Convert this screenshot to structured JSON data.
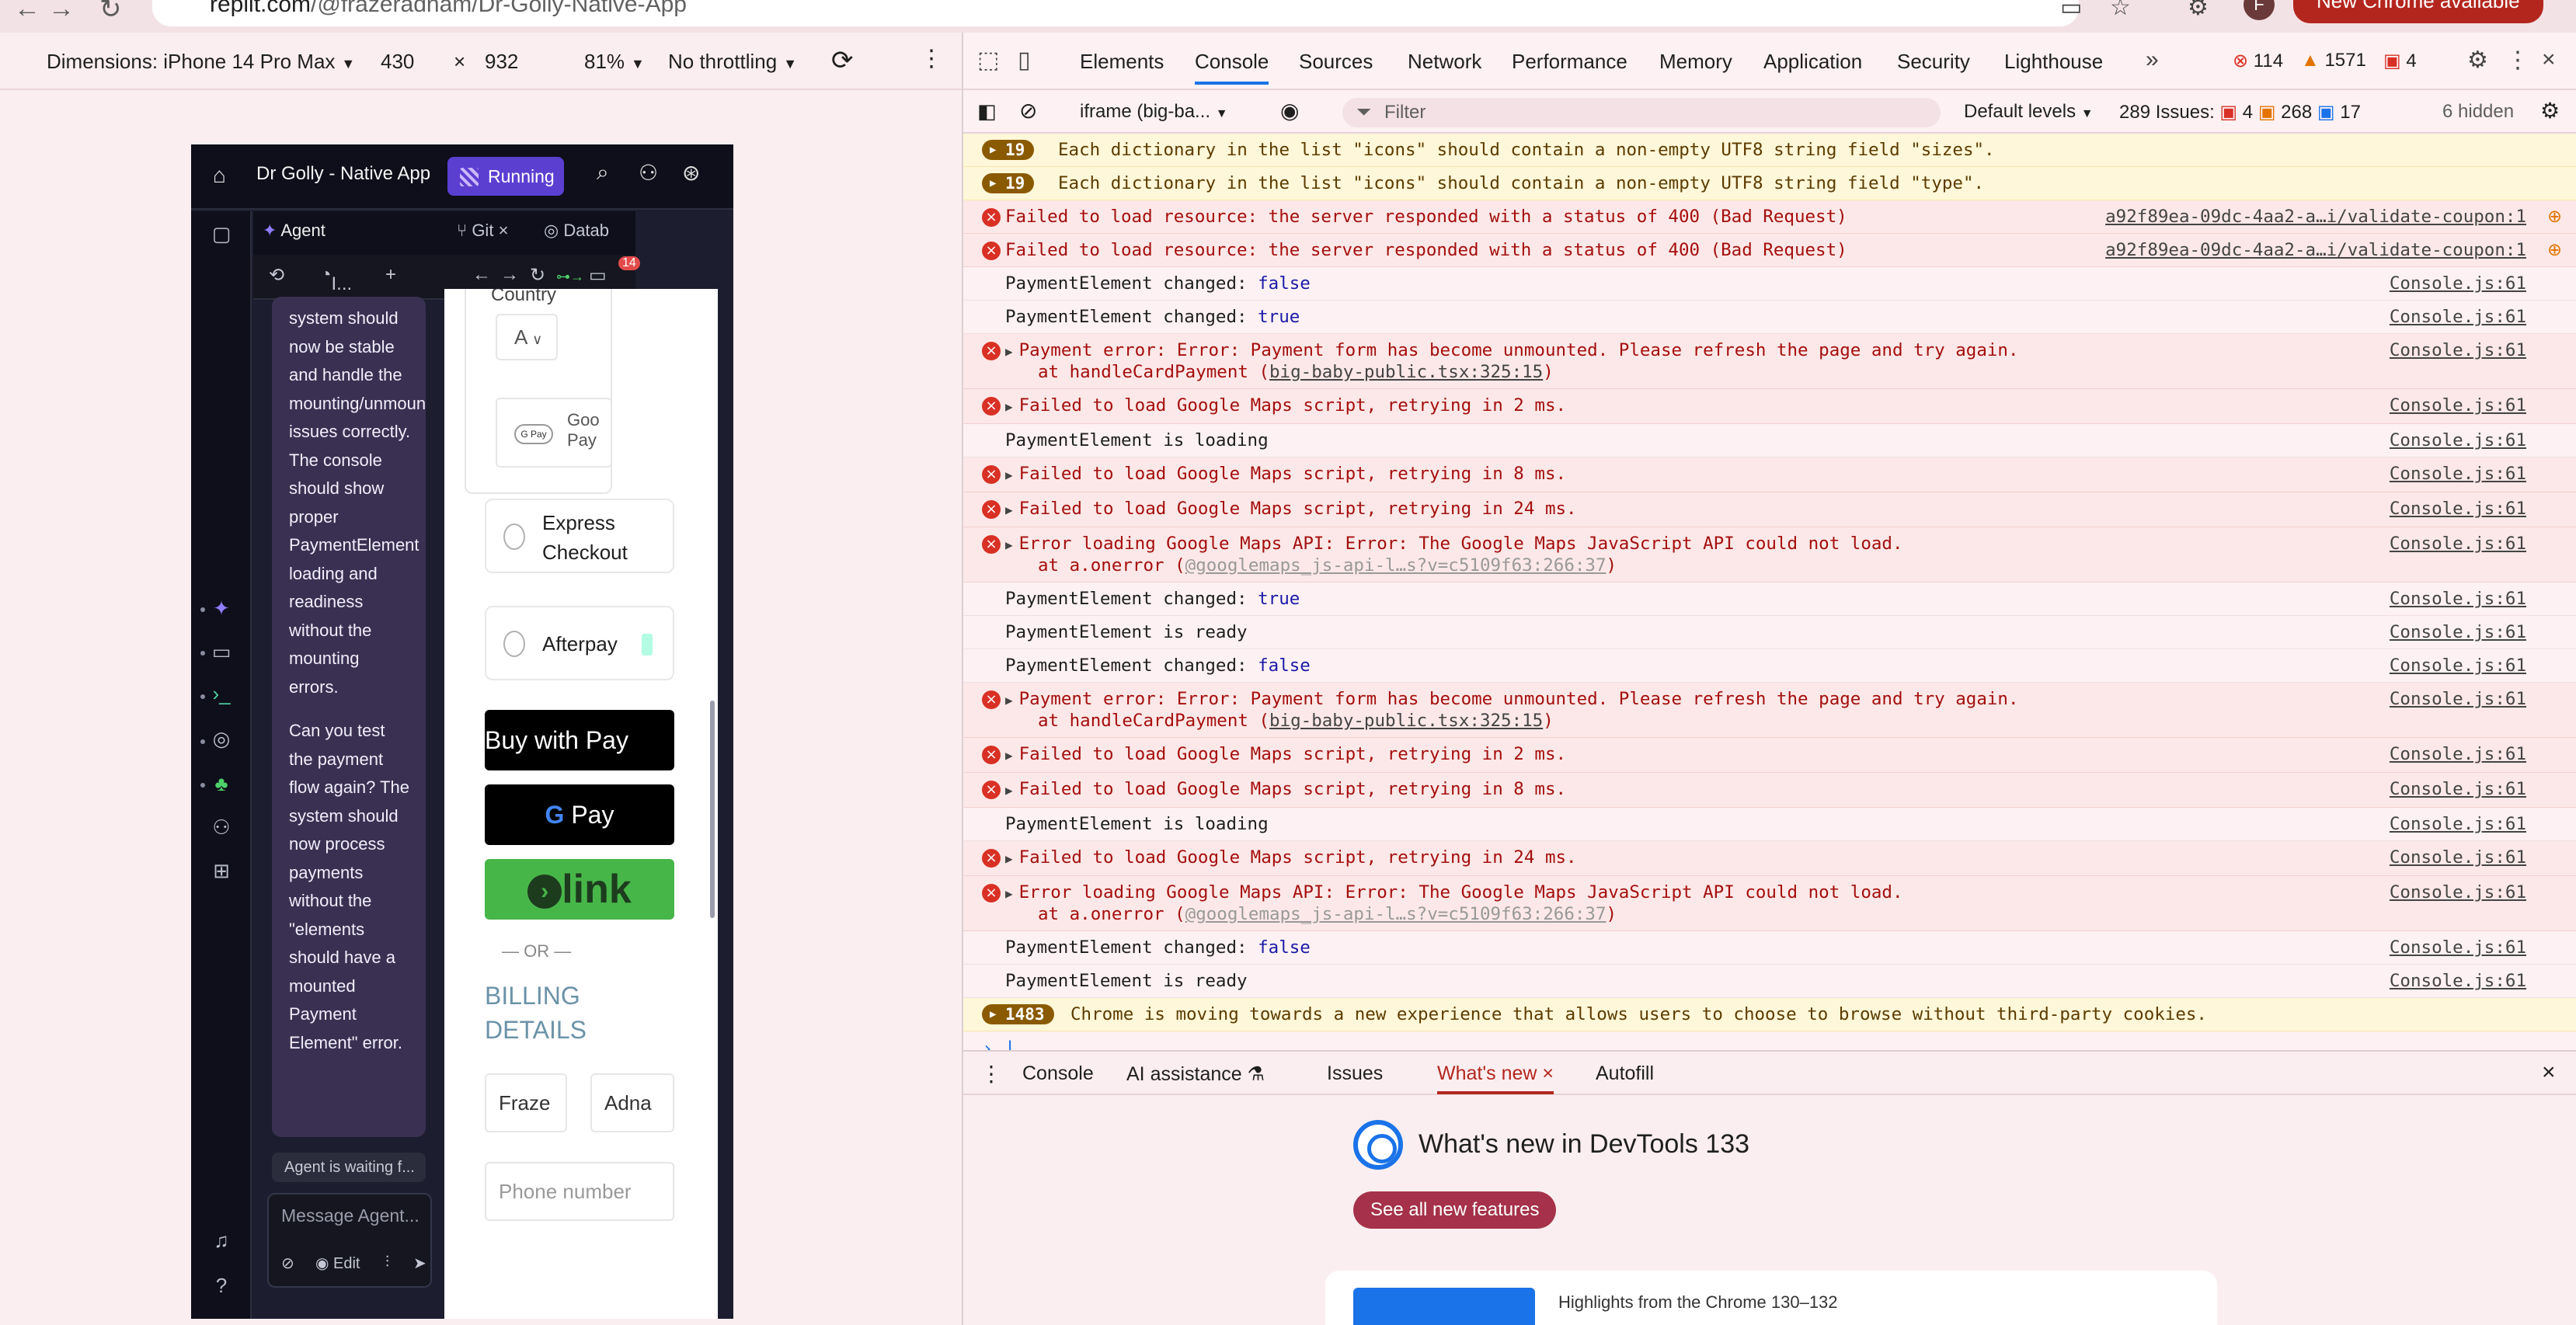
{
  "browser": {
    "url_host": "replit.com",
    "url_path": "/@frazeradnam/Dr-Golly-Native-App",
    "avatar_letter": "F",
    "update_label": "New Chrome available"
  },
  "device_toolbar": {
    "dimensions_label": "Dimensions: iPhone 14 Pro Max",
    "width": "430",
    "height": "932",
    "zoom": "81%",
    "throttling": "No throttling"
  },
  "replit": {
    "project_title": "Dr Golly - Native App",
    "run_label": "Running",
    "tab_agent": "Agent",
    "tab_git": "Git",
    "tab_database": "Datab",
    "agent_tool_label": "I...",
    "agent_message_1": "system should now be stable and handle the mounting/unmounting issues correctly. The console should show proper PaymentElement loading and readiness without the mounting errors.",
    "agent_message_2": "Can you test the payment flow again? The system should now process payments without the \"elements should have a mounted Payment Element\" error.",
    "agent_waiting": "Agent is waiting f...",
    "composer_placeholder": "Message Agent...",
    "composer_edit": "Edit",
    "badge_count": "14"
  },
  "preview": {
    "country_label": "Country",
    "country_value": "A",
    "gpay_small": "G Pay",
    "gpay_text_1": "Goo",
    "gpay_text_2": "Pay",
    "express_checkout": "Express Checkout",
    "afterpay": "Afterpay",
    "apple_pay_prefix": "Buy with",
    "apple_pay_suffix": "Pay",
    "google_pay": "Pay",
    "link_label": "link",
    "or_divider": "— OR —",
    "billing_title": "BILLING DETAILS",
    "first_name": "Fraze",
    "last_name": "Adna",
    "phone_placeholder": "Phone number"
  },
  "devtools": {
    "tabs": [
      "Elements",
      "Console",
      "Sources",
      "Network",
      "Performance",
      "Memory",
      "Application",
      "Security",
      "Lighthouse"
    ],
    "active_tab": "Console",
    "error_count": "114",
    "warning_count": "1571",
    "issue_count": "4",
    "context": "iframe (big-ba...",
    "filter_placeholder": "Filter",
    "levels": "Default levels",
    "issues_label": "289 Issues:",
    "issues_red": "4",
    "issues_yellow": "268",
    "issues_blue": "17",
    "hidden": "6 hidden"
  },
  "console_rows": [
    {
      "type": "warn",
      "badge": "19",
      "text": "Each dictionary in the list \"icons\" should contain a non-empty UTF8 string field \"sizes\".",
      "src": ""
    },
    {
      "type": "warn",
      "badge": "19",
      "text": "Each dictionary in the list \"icons\" should contain a non-empty UTF8 string field \"type\".",
      "src": ""
    },
    {
      "type": "err",
      "text": "Failed to load resource: the server responded with a status of 400 (Bad Request)",
      "src": "a92f89ea-09dc-4aa2-a…i/validate-coupon:1"
    },
    {
      "type": "err",
      "text": "Failed to load resource: the server responded with a status of 400 (Bad Request)",
      "src": "a92f89ea-09dc-4aa2-a…i/validate-coupon:1"
    },
    {
      "type": "log",
      "text": "PaymentElement changed: ",
      "kw": "false",
      "src": "Console.js:61"
    },
    {
      "type": "log",
      "text": "PaymentElement changed: ",
      "kw": "true",
      "src": "Console.js:61"
    },
    {
      "type": "err",
      "tri": true,
      "text": "Payment error: Error: Payment form has become unmounted. Please refresh the page and try again.",
      "stack_at": "at handleCardPayment (",
      "stack_link": "big-baby-public.tsx:325:15",
      "src": "Console.js:61"
    },
    {
      "type": "err",
      "tri": true,
      "text": "Failed to load Google Maps script, retrying in 2 ms.",
      "src": "Console.js:61"
    },
    {
      "type": "log",
      "text": "PaymentElement is loading",
      "src": "Console.js:61"
    },
    {
      "type": "err",
      "tri": true,
      "text": "Failed to load Google Maps script, retrying in 8 ms.",
      "src": "Console.js:61"
    },
    {
      "type": "err",
      "tri": true,
      "text": "Failed to load Google Maps script, retrying in 24 ms.",
      "src": "Console.js:61"
    },
    {
      "type": "err",
      "tri": true,
      "text": "Error loading Google Maps API: Error: The Google Maps JavaScript API could not load.",
      "stack_at": "at a.onerror (",
      "stack_link": "@googlemaps_js-api-l…s?v=c5109f63:266:37",
      "dim": true,
      "src": "Console.js:61"
    },
    {
      "type": "log",
      "text": "PaymentElement changed: ",
      "kw": "true",
      "src": "Console.js:61"
    },
    {
      "type": "log",
      "text": "PaymentElement is ready",
      "src": "Console.js:61"
    },
    {
      "type": "log",
      "text": "PaymentElement changed: ",
      "kw": "false",
      "src": "Console.js:61"
    },
    {
      "type": "err",
      "tri": true,
      "text": "Payment error: Error: Payment form has become unmounted. Please refresh the page and try again.",
      "stack_at": "at handleCardPayment (",
      "stack_link": "big-baby-public.tsx:325:15",
      "src": "Console.js:61"
    },
    {
      "type": "err",
      "tri": true,
      "text": "Failed to load Google Maps script, retrying in 2 ms.",
      "src": "Console.js:61"
    },
    {
      "type": "err",
      "tri": true,
      "text": "Failed to load Google Maps script, retrying in 8 ms.",
      "src": "Console.js:61"
    },
    {
      "type": "log",
      "text": "PaymentElement is loading",
      "src": "Console.js:61"
    },
    {
      "type": "err",
      "tri": true,
      "text": "Failed to load Google Maps script, retrying in 24 ms.",
      "src": "Console.js:61"
    },
    {
      "type": "err",
      "tri": true,
      "text": "Error loading Google Maps API: Error: The Google Maps JavaScript API could not load.",
      "stack_at": "at a.onerror (",
      "stack_link": "@googlemaps_js-api-l…s?v=c5109f63:266:37",
      "dim": true,
      "src": "Console.js:61"
    },
    {
      "type": "log",
      "text": "PaymentElement changed: ",
      "kw": "false",
      "src": "Console.js:61"
    },
    {
      "type": "log",
      "text": "PaymentElement is ready",
      "src": "Console.js:61"
    },
    {
      "type": "warn",
      "badge": "1483",
      "text": "Chrome is moving towards a new experience that allows users to choose to browse without third-party cookies.",
      "src": ""
    }
  ],
  "drawer": {
    "tabs": [
      "Console",
      "AI assistance",
      "Issues",
      "What's new",
      "Autofill"
    ],
    "active_tab": "What's new",
    "whatsnew_title": "What's new in DevTools 133",
    "whatsnew_button": "See all new features",
    "card_text": "Highlights from the Chrome 130–132"
  },
  "colors": {
    "accent": "#1a73e8",
    "error": "#d93025",
    "warning": "#e37400",
    "replit_purple": "#5b3fd1",
    "link_green": "#47b649"
  }
}
